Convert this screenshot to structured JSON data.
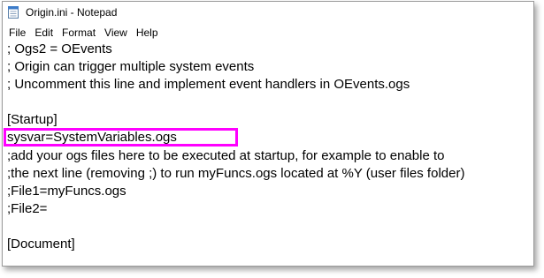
{
  "window": {
    "title": "Origin.ini - Notepad",
    "icon": "notepad-icon"
  },
  "menu": [
    {
      "label": "File"
    },
    {
      "label": "Edit"
    },
    {
      "label": "Format"
    },
    {
      "label": "View"
    },
    {
      "label": "Help"
    }
  ],
  "editor": {
    "lines": [
      "; Ogs2 = OEvents",
      "; Origin can trigger multiple system events",
      "; Uncomment this line and implement event handlers in OEvents.ogs",
      "",
      "[Startup]",
      "sysvar=SystemVariables.ogs",
      ";add your ogs files here to be executed at startup, for example to enable to",
      ";the next line (removing ;) to run myFuncs.ogs located at %Y (user files folder)",
      ";File1=myFuncs.ogs",
      ";File2=",
      "",
      "[Document]"
    ]
  },
  "annotation": {
    "highlight_color": "#ff00ff"
  }
}
